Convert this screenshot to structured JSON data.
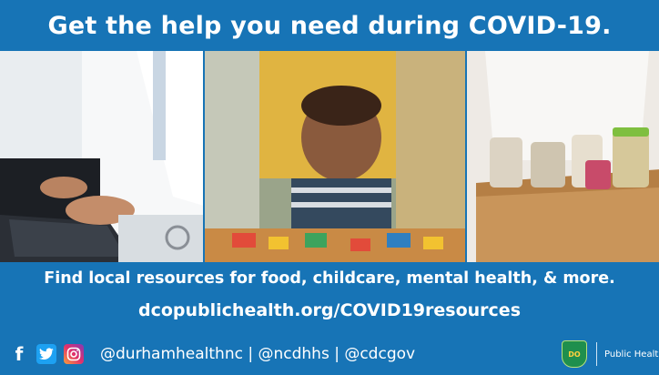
{
  "header": {
    "title": "Get the help you need during COVID-19."
  },
  "body": {
    "line1": "Find local resources for food, childcare, mental health, & more.",
    "line2": "dcopublichealth.org/COVID19resources"
  },
  "footer": {
    "handles": "@durhamhealthnc  | @ncdhhs | @cdcgov",
    "logo_text": "Public Health"
  },
  "colors": {
    "background": "#1774b6",
    "text": "#ffffff"
  }
}
